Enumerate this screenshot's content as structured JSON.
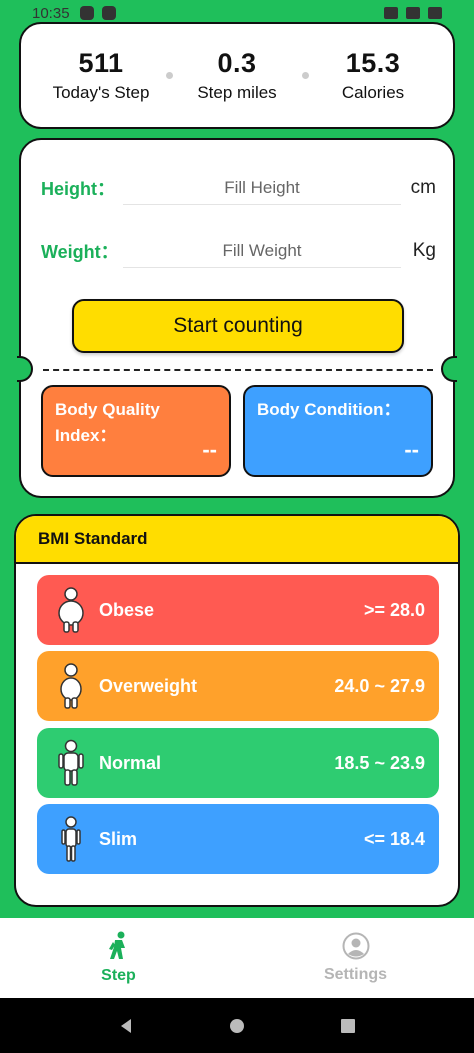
{
  "status_bar": {
    "time": "10:35"
  },
  "stats": [
    {
      "value": "511",
      "label": "Today's Step"
    },
    {
      "value": "0.3",
      "label": "Step miles"
    },
    {
      "value": "15.3",
      "label": "Calories"
    }
  ],
  "form": {
    "height_label": "Height：",
    "height_placeholder": "Fill Height",
    "height_unit": "cm",
    "weight_label": "Weight：",
    "weight_placeholder": "Fill Weight",
    "weight_unit": "Kg",
    "start_button": "Start counting"
  },
  "metrics": {
    "bqi_title": "Body Quality Index：",
    "bqi_value": "--",
    "condition_title": "Body Condition：",
    "condition_value": "--"
  },
  "bmi": {
    "title": "BMI Standard",
    "rows": [
      {
        "name": "Obese",
        "range": ">= 28.0",
        "color": "#ff5a52"
      },
      {
        "name": "Overweight",
        "range": "24.0 ~ 27.9",
        "color": "#ffa12b"
      },
      {
        "name": "Normal",
        "range": "18.5 ~ 23.9",
        "color": "#2ecc71"
      },
      {
        "name": "Slim",
        "range": "<= 18.4",
        "color": "#3ea0ff"
      }
    ]
  },
  "nav": {
    "step_label": "Step",
    "settings_label": "Settings"
  },
  "colors": {
    "background": "#1fbf5b",
    "accent_yellow": "#ffdd00",
    "accent_green": "#1bb05a"
  }
}
